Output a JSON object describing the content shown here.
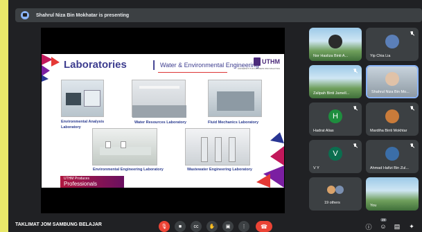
{
  "presenter_banner": "Shahrul Niza Bin Mokhatar is presenting",
  "slide": {
    "title": "Laboratories",
    "separator": "|",
    "subtitle": "Water & Environmental Engineering",
    "logo": "UTHM",
    "logo_tagline": "UNIVERSITI TUN HUSSEIN ONN MALAYSIA",
    "labs": [
      "Environmental Analysis Laboratory",
      "Water Resources Laboratory",
      "Fluid Mechanics Laboratory",
      "Environmental Engineering Laboratory",
      "Wastewater Engineering Laboratory"
    ],
    "footer_small": "UTHM Produces",
    "footer_big": "Professionals"
  },
  "participants": [
    {
      "name": "Nor Hasliza Binti A..."
    },
    {
      "name": "Yip Chia Lia"
    },
    {
      "name": "Zalipah Binti Jamell..."
    },
    {
      "name": "Shahrul Niza Bin Mo..."
    },
    {
      "name": "Hadrat Alias",
      "initial": "H"
    },
    {
      "name": "Mardiha Binti Mokhtar"
    },
    {
      "name": "V Y",
      "initial": "V"
    },
    {
      "name": "Ahmad Hafizi Bin Zul..."
    },
    {
      "name": "19 others"
    },
    {
      "name": "You"
    }
  ],
  "meeting_title": "TAKLIMAT JOM SAMBUNG BELAJAR",
  "participant_count": "29",
  "colors": {
    "accent_red": "#ea4335",
    "tile_bg": "#3c4043",
    "bg": "#202124",
    "letter_green": "#1e8e3e"
  }
}
